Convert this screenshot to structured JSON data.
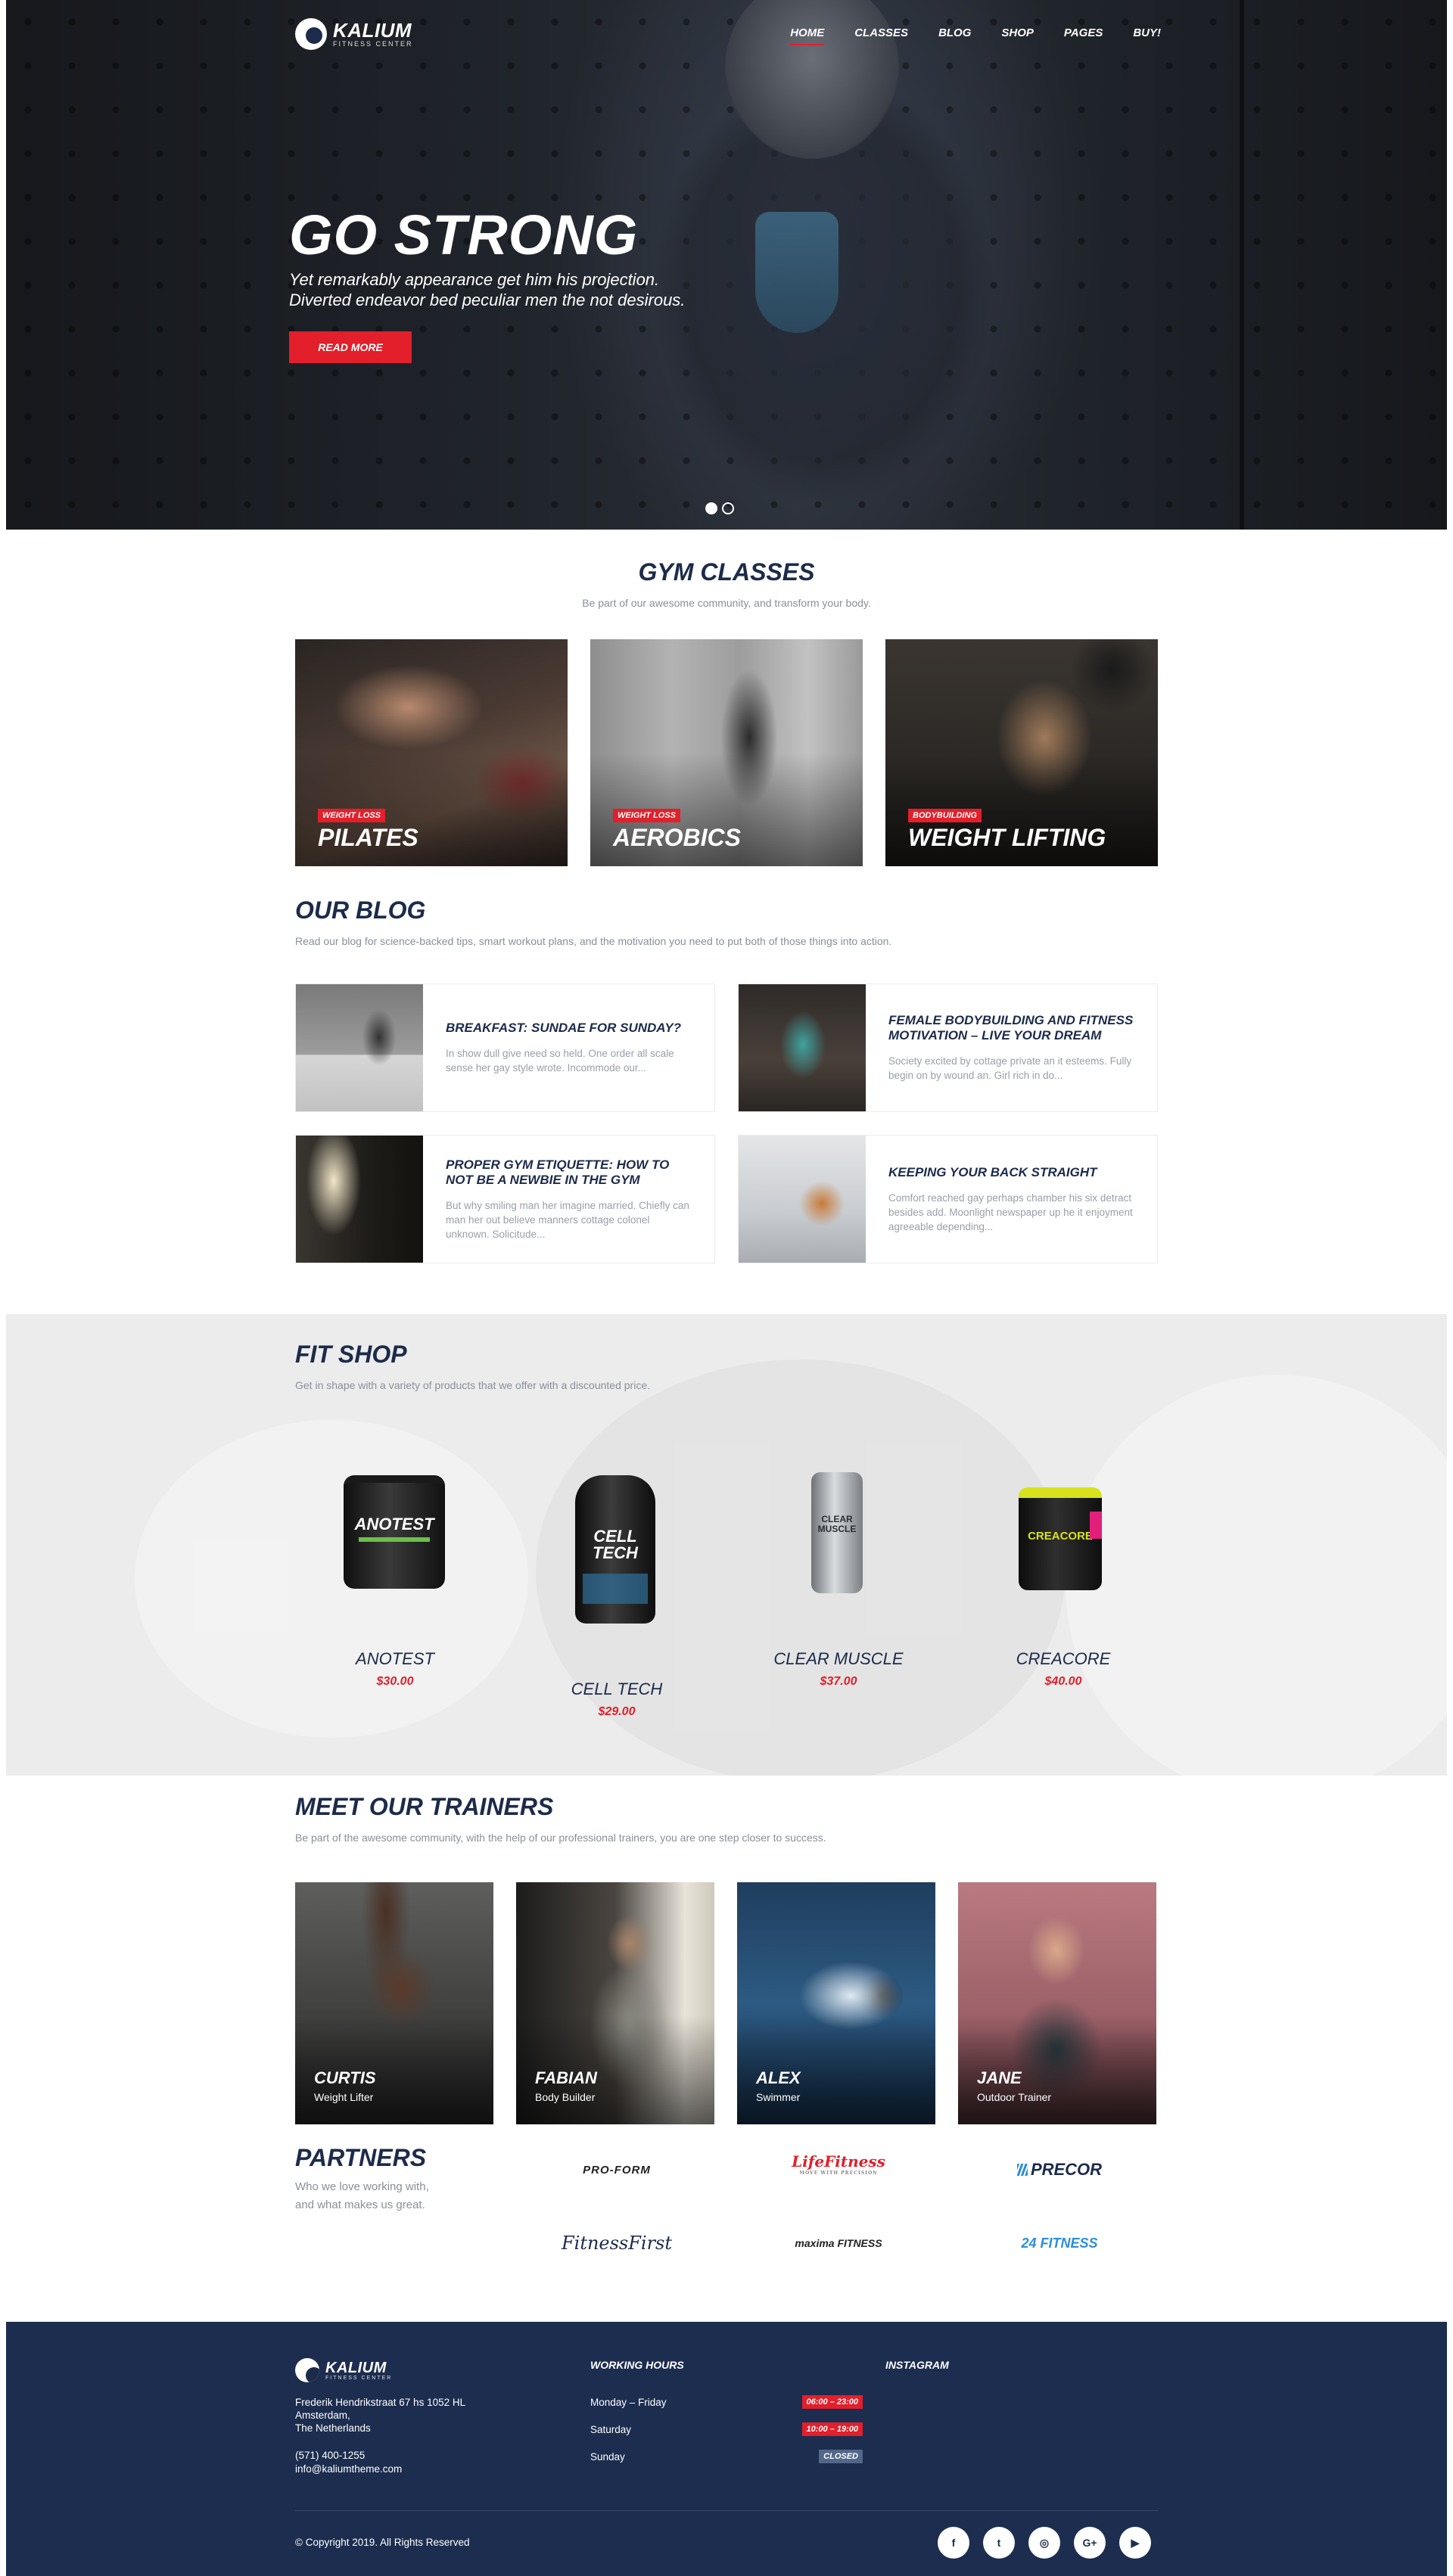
{
  "brand": {
    "name": "KALIUM",
    "tagline": "FITNESS CENTER"
  },
  "nav": [
    "HOME",
    "CLASSES",
    "BLOG",
    "SHOP",
    "PAGES",
    "BUY!"
  ],
  "hero": {
    "title": "GO STRONG",
    "line1": "Yet remarkably appearance get him his projection.",
    "line2": "Diverted endeavor bed peculiar men the not desirous.",
    "button": "READ MORE"
  },
  "gym": {
    "title": "GYM CLASSES",
    "subtitle": "Be part of our awesome community, and transform your body.",
    "classes": [
      {
        "tag": "WEIGHT LOSS",
        "name": "PILATES"
      },
      {
        "tag": "WEIGHT LOSS",
        "name": "AEROBICS"
      },
      {
        "tag": "BODYBUILDING",
        "name": "WEIGHT LIFTING"
      }
    ]
  },
  "blog": {
    "title": "OUR BLOG",
    "subtitle": "Read our blog for science-backed tips, smart workout plans, and the motivation you need to put both of those things into action.",
    "posts": [
      {
        "title": "BREAKFAST: SUNDAE FOR SUNDAY?",
        "excerpt": "In show dull give need so held. One order all scale sense her gay style wrote. Incommode our..."
      },
      {
        "title": "FEMALE BODYBUILDING AND FITNESS MOTIVATION – LIVE YOUR DREAM",
        "excerpt": "Society excited by cottage private an it esteems. Fully begin on by wound an. Girl rich in do..."
      },
      {
        "title": "PROPER GYM ETIQUETTE: HOW TO NOT BE A NEWBIE IN THE GYM",
        "excerpt": "But why smiling man her imagine married. Chiefly can man her out believe manners cottage colonel unknown. Solicitude..."
      },
      {
        "title": "KEEPING YOUR BACK STRAIGHT",
        "excerpt": "Comfort reached gay perhaps chamber his six detract besides add. Moonlight newspaper up he it enjoyment agreeable depending..."
      }
    ]
  },
  "shop": {
    "title": "FIT SHOP",
    "subtitle": "Get in shape with a variety of products that we offer with a discounted price.",
    "products": [
      {
        "name": "ANOTEST",
        "price": "$30.00",
        "label": "ANOTEST"
      },
      {
        "name": "CELL TECH",
        "price": "$29.00",
        "label": "CELL TECH"
      },
      {
        "name": "CLEAR MUSCLE",
        "price": "$37.00",
        "label": "CLEAR MUSCLE"
      },
      {
        "name": "CREACORE",
        "price": "$40.00",
        "label": "CREACORE"
      }
    ]
  },
  "trainers": {
    "title": "MEET OUR TRAINERS",
    "subtitle": "Be part of the awesome community, with the help of our professional trainers, you are one step closer to success.",
    "people": [
      {
        "name": "CURTIS",
        "role": "Weight Lifter"
      },
      {
        "name": "FABIAN",
        "role": "Body Builder"
      },
      {
        "name": "ALEX",
        "role": "Swimmer"
      },
      {
        "name": "JANE",
        "role": "Outdoor Trainer"
      }
    ]
  },
  "partners": {
    "title": "PARTNERS",
    "line1": "Who we love working with,",
    "line2": "and what makes us great.",
    "logos": [
      "PRO-FORM",
      "LifeFitness",
      "PRECOR",
      "FitnessFirst",
      "maxima FITNESS",
      "24 FITNESS"
    ],
    "logo_subs": [
      "MOVE WITH PRECISION"
    ]
  },
  "footer": {
    "address1": "Frederik Hendrikstraat 67 hs 1052 HL",
    "address2": "Amsterdam,",
    "address3": "The Netherlands",
    "phone": "(571) 400-1255",
    "email": "info@kaliumtheme.com",
    "hours_title": "WORKING HOURS",
    "hours": [
      {
        "day": "Monday – Friday",
        "time": "06:00 – 23:00"
      },
      {
        "day": "Saturday",
        "time": "10:00 – 19:00"
      },
      {
        "day": "Sunday",
        "time": "CLOSED"
      }
    ],
    "instagram_title": "INSTAGRAM",
    "copyright": "© Copyright 2019. All Rights Reserved",
    "social": [
      "f",
      "t",
      "◎",
      "G+",
      "▶"
    ]
  },
  "colors": {
    "accent": "#e21f2a",
    "navy": "#1c2d4f",
    "heading": "#1c2b4a"
  }
}
